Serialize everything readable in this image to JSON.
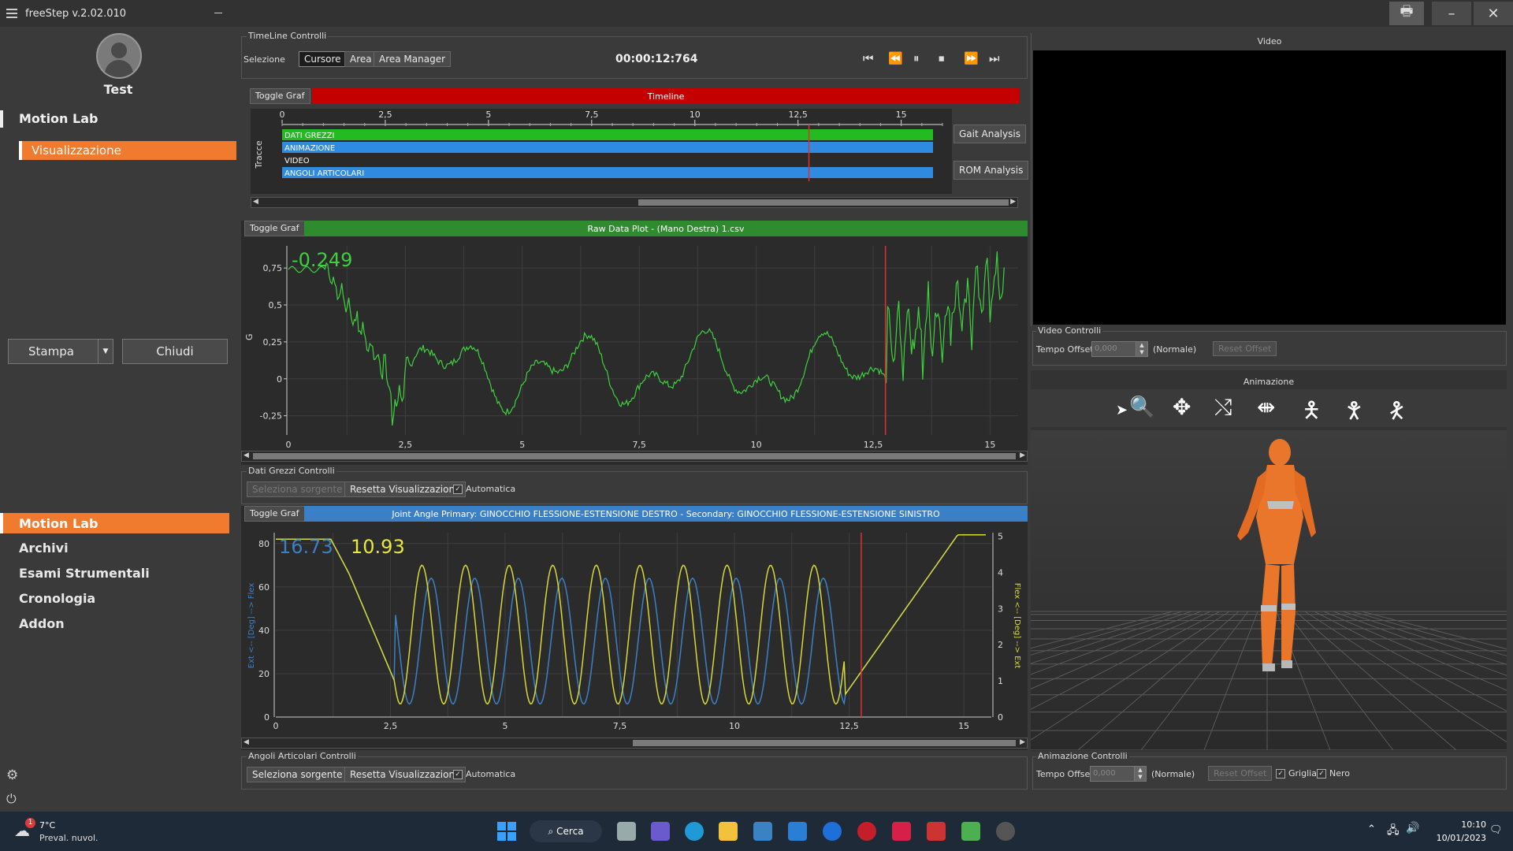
{
  "app": {
    "title": "freeStep v.2.02.010",
    "user": "Test"
  },
  "sidebar": {
    "section": "Motion Lab",
    "sub_item": "Visualizzazione",
    "print_button": "Stampa",
    "close_button": "Chiudi",
    "nav": [
      "Motion Lab",
      "Archivi",
      "Esami Strumentali",
      "Cronologia",
      "Addon"
    ]
  },
  "timeline_controls": {
    "group": "TimeLine Controlli",
    "selection_label": "Selezione",
    "modes": [
      "Cursore",
      "Area",
      "Area Manager"
    ],
    "time": "00:00:12:764"
  },
  "timeline": {
    "toggle": "Toggle Graf",
    "title": "Timeline",
    "tracks_label": "Tracce",
    "tracks": [
      "DATI GREZZI",
      "ANIMAZIONE",
      "VIDEO",
      "ANGOLI ARTICOLARI"
    ],
    "ticks": [
      "0",
      "2,5",
      "5",
      "7,5",
      "10",
      "12,5",
      "15"
    ],
    "gait_button": "Gait Analysis",
    "rom_button": "ROM Analysis",
    "cursor": 12.764
  },
  "raw_plot": {
    "toggle": "Toggle Graf",
    "title": "Raw Data Plot - (Mano Destra) 1.csv",
    "value": "-0.249",
    "ylabel": "G",
    "yticks": [
      "0,75",
      "0,5",
      "0,25",
      "0",
      "-0,25"
    ],
    "xticks": [
      "0",
      "2,5",
      "5",
      "7,5",
      "10",
      "12,5",
      "15"
    ]
  },
  "raw_controls": {
    "group": "Dati Grezzi Controlli",
    "source_button": "Seleziona sorgente",
    "reset_button": "Resetta Visualizzazione",
    "auto_label": "Automatica"
  },
  "angle_plot": {
    "toggle": "Toggle Graf",
    "title": "Joint Angle Primary: GINOCCHIO FLESSIONE-ESTENSIONE DESTRO - Secondary: GINOCCHIO FLESSIONE-ESTENSIONE SINISTRO",
    "primary_value": "16.73",
    "secondary_value": "10.93",
    "ylabel_left": "Ext <-- [Deg] --> Flex",
    "ylabel_right": "Flex <-- [Deg] --> Ext",
    "yticks_left": [
      "80",
      "60",
      "40",
      "20",
      "0"
    ],
    "yticks_right": [
      "5",
      "4",
      "3",
      "2",
      "1",
      "0"
    ],
    "xticks": [
      "0",
      "2,5",
      "5",
      "7,5",
      "10",
      "12,5",
      "15"
    ]
  },
  "angle_controls": {
    "group": "Angoli Articolari Controlli",
    "source_button": "Seleziona sorgente",
    "reset_button": "Resetta Visualizzazione",
    "auto_label": "Automatica"
  },
  "video": {
    "title": "Video",
    "controls_group": "Video Controlli",
    "offset_label": "Tempo Offset",
    "offset_value": "0,000",
    "mode": "(Normale)",
    "reset_offset": "Reset Offset"
  },
  "animation": {
    "title": "Animazione",
    "controls_group": "Animazione Controlli",
    "offset_label": "Tempo Offset",
    "offset_value": "0,000",
    "mode": "(Normale)",
    "reset_offset": "Reset Offset",
    "grid_label": "Griglia",
    "black_label": "Nero"
  },
  "taskbar": {
    "weather_temp": "7°C",
    "weather_desc": "Preval. nuvol.",
    "weather_badge": "1",
    "search": "Cerca",
    "time": "10:10",
    "date": "10/01/2023"
  },
  "colors": {
    "accent": "#f07b2e",
    "timeline_red": "#c40000",
    "raw_green": "#33aa33",
    "angle_blue": "#3b80c6"
  }
}
